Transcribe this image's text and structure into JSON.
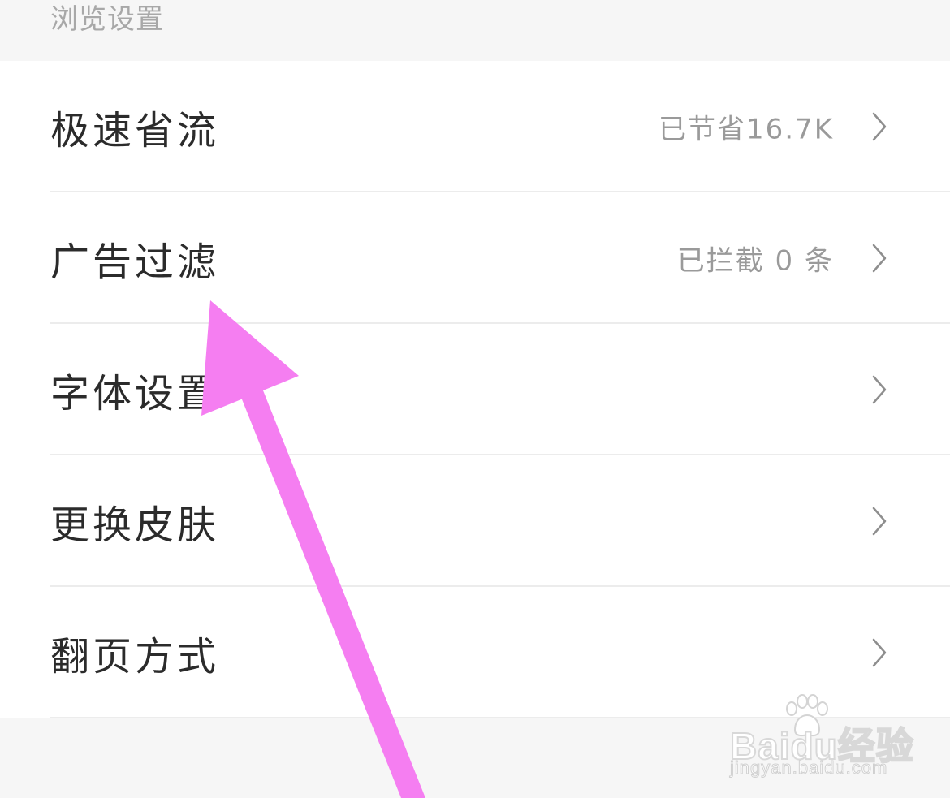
{
  "section": {
    "title": "浏览设置"
  },
  "items": [
    {
      "label": "极速省流",
      "value": "已节省16.7K"
    },
    {
      "label": "广告过滤",
      "value": "已拦截 0 条"
    },
    {
      "label": "字体设置",
      "value": ""
    },
    {
      "label": "更换皮肤",
      "value": ""
    },
    {
      "label": "翻页方式",
      "value": ""
    }
  ],
  "icons": {
    "row_chevron": "chevron-right-icon",
    "annotation": "pink-arrow-annotation",
    "watermark_logo": "baidu-paw-logo"
  },
  "colors": {
    "annotation_arrow": "#f57ef1",
    "label_text": "#2b2b2b",
    "value_text": "#9a9a9a",
    "header_text": "#a8a8a8",
    "background": "#f6f6f6"
  },
  "watermark": {
    "brand": "Baidu经验",
    "url": "jingyan.baidu.com"
  }
}
